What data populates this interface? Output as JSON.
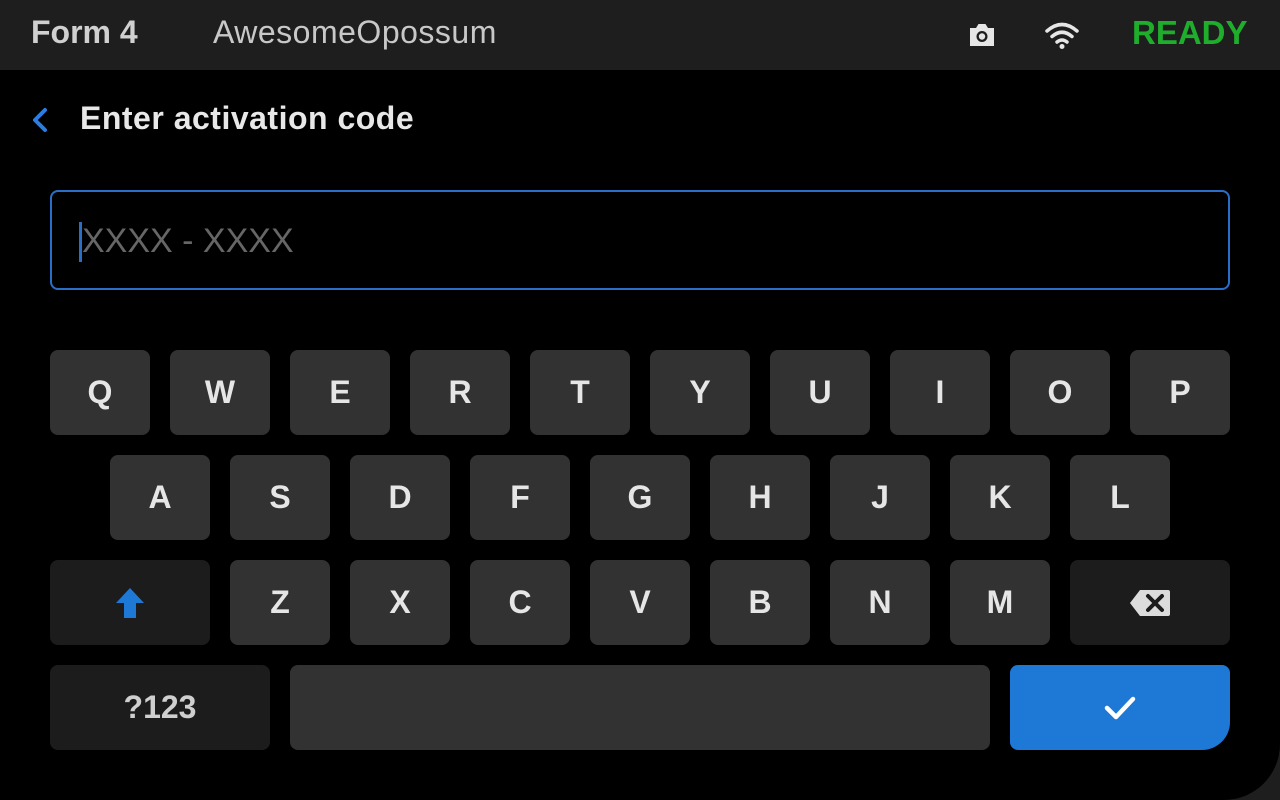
{
  "status_bar": {
    "device": "Form 4",
    "printer_name": "AwesomeOpossum",
    "camera_icon": "camera-icon",
    "wifi_icon": "wifi-icon",
    "status": "READY",
    "status_color": "#1fae2c"
  },
  "header": {
    "back_icon": "chevron-left-icon",
    "title": "Enter activation code"
  },
  "code_input": {
    "placeholder": "XXXX - XXXX",
    "value": ""
  },
  "keyboard": {
    "row1": [
      "Q",
      "W",
      "E",
      "R",
      "T",
      "Y",
      "U",
      "I",
      "O",
      "P"
    ],
    "row2": [
      "A",
      "S",
      "D",
      "F",
      "G",
      "H",
      "J",
      "K",
      "L"
    ],
    "row3": [
      "Z",
      "X",
      "C",
      "V",
      "B",
      "N",
      "M"
    ],
    "shift_icon": "shift-arrow-icon",
    "backspace_icon": "backspace-icon",
    "symbols_label": "?123",
    "space_label": "",
    "done_icon": "checkmark-icon",
    "accent_color": "#1e78d6"
  }
}
